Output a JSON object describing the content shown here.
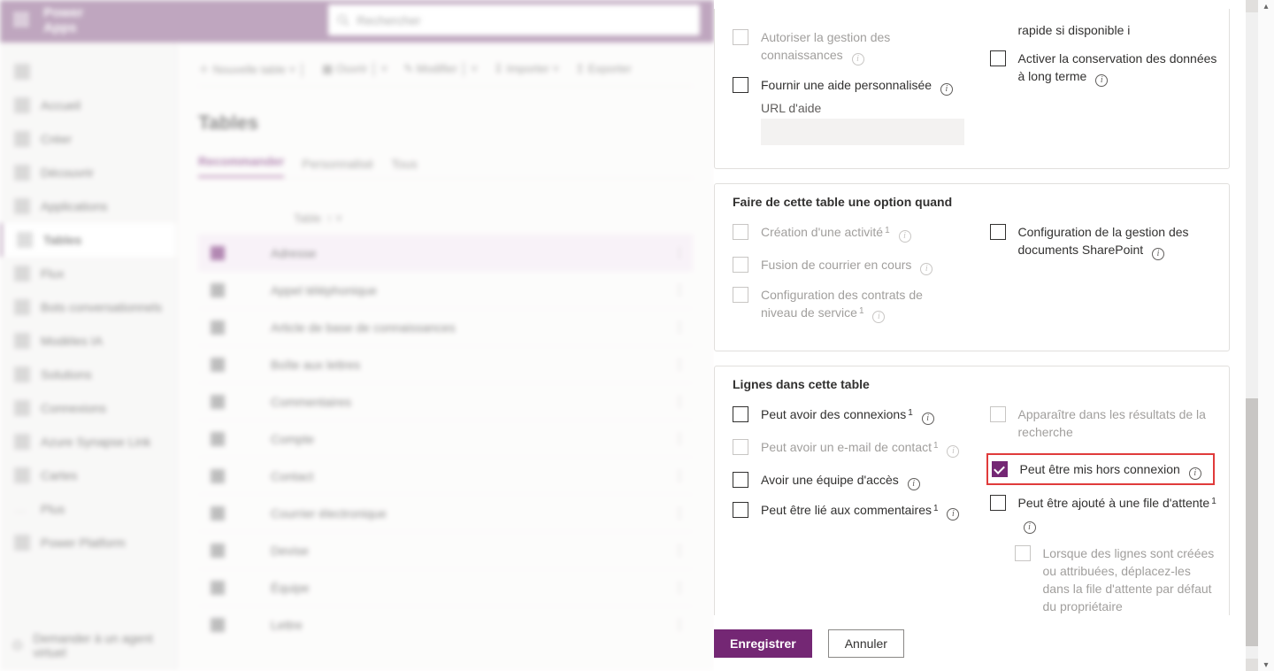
{
  "app": {
    "name": "Power Apps",
    "search_placeholder": "Rechercher"
  },
  "sidebar": {
    "items": [
      {
        "label": "Accueil"
      },
      {
        "label": "Créer"
      },
      {
        "label": "Découvrir"
      },
      {
        "label": "Applications"
      },
      {
        "label": "Tables",
        "selected": true
      },
      {
        "label": "Flux"
      },
      {
        "label": "Bots conversationnels"
      },
      {
        "label": "Modèles IA"
      },
      {
        "label": "Solutions"
      },
      {
        "label": "Connexions"
      },
      {
        "label": "Azure Synapse Link"
      },
      {
        "label": "Cartes"
      },
      {
        "label": "Plus"
      }
    ],
    "power_platform": "Power Platform",
    "footer": "Demander à un agent virtuel"
  },
  "commandbar": {
    "new_table": "Nouvelle table",
    "ouvrir": "Ouvrir",
    "modifier": "Modifier",
    "importer": "Importer",
    "exporter": "Exporter"
  },
  "page": {
    "title": "Tables",
    "tabs": [
      {
        "label": "Recommander",
        "active": true
      },
      {
        "label": "Personnalisé"
      },
      {
        "label": "Tous"
      }
    ],
    "column_header": "Table",
    "rows": [
      {
        "label": "Adresse",
        "selected": true
      },
      {
        "label": "Appel téléphonique"
      },
      {
        "label": "Article de base de connaissances"
      },
      {
        "label": "Boîte aux lettres"
      },
      {
        "label": "Commentaires"
      },
      {
        "label": "Compte"
      },
      {
        "label": "Contact"
      },
      {
        "label": "Courrier électronique"
      },
      {
        "label": "Devise"
      },
      {
        "label": "Équipe"
      },
      {
        "label": "Lettre"
      }
    ]
  },
  "panel": {
    "section1": {
      "opts_left": [
        {
          "label": "Autoriser la gestion des connaissances",
          "disabled": true,
          "info": true
        },
        {
          "label": "Fournir une aide personnalisée",
          "info": true
        }
      ],
      "help_url_label": "URL d'aide",
      "opts_right": [
        {
          "label": "rapide si disponible",
          "info_only": true
        },
        {
          "label": "Activer la conservation des données à long terme",
          "info": true
        }
      ]
    },
    "section2": {
      "title": "Faire de cette table une option quand",
      "opts_left": [
        {
          "label": "Création d'une activité",
          "sup": true,
          "disabled": true,
          "info": true
        },
        {
          "label": "Fusion de courrier en cours",
          "disabled": true,
          "info": true
        },
        {
          "label": "Configuration des contrats de niveau de service",
          "sup": true,
          "disabled": true,
          "info": true
        }
      ],
      "opts_right": [
        {
          "label": "Configuration de la gestion des documents SharePoint",
          "info": true
        }
      ]
    },
    "section3": {
      "title": "Lignes dans cette table",
      "opts_left": [
        {
          "label": "Peut avoir des connexions",
          "sup": true,
          "info": true
        },
        {
          "label": "Peut avoir un e-mail de contact",
          "sup": true,
          "disabled": true,
          "info": true
        },
        {
          "label": "Avoir une équipe d'accès",
          "info": true
        },
        {
          "label": "Peut être lié aux commentaires",
          "sup": true,
          "info": true
        }
      ],
      "opts_right": [
        {
          "label": "Apparaître dans les résultats de la recherche",
          "disabled": true
        },
        {
          "label": "Peut être mis hors connexion",
          "checked": true,
          "info": true,
          "highlighted": true
        },
        {
          "label": "Peut être ajouté à une file d'attente",
          "sup": true,
          "info": true
        },
        {
          "label_sub": "Lorsque des lignes sont créées ou attribuées, déplacez-les dans la file d'attente par défaut du propriétaire",
          "disabled": true,
          "indent": true
        }
      ]
    },
    "footer": {
      "save": "Enregistrer",
      "cancel": "Annuler"
    }
  }
}
